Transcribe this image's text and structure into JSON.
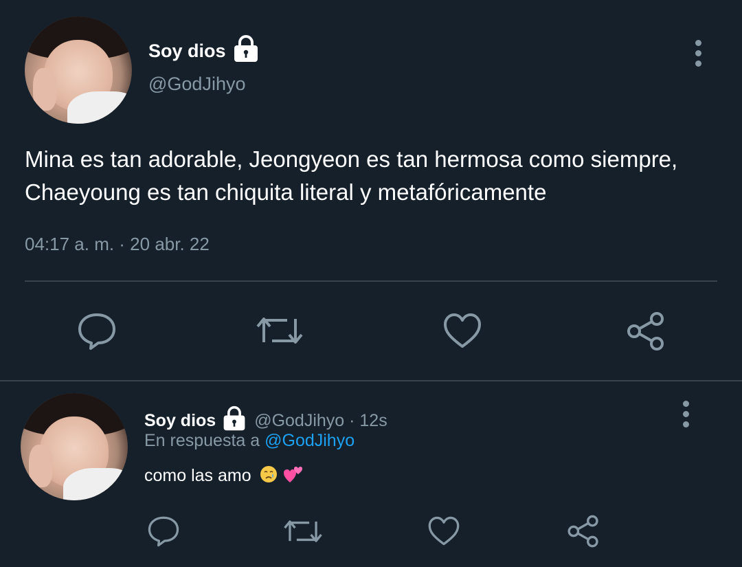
{
  "tweet": {
    "display_name": "Soy dios",
    "handle": "@GodJihyo",
    "text": "Mina es tan adorable, Jeongyeon es tan hermosa como siempre, Chaeyoung es tan chiquita literal y metafóricamente",
    "timestamp": "04:17 a. m. · 20 abr. 22",
    "avatar_icon": "profile-photo",
    "actions": [
      "reply-icon",
      "retweet-icon",
      "like-icon",
      "share-icon"
    ]
  },
  "reply": {
    "display_name": "Soy dios",
    "handle_time": "@GodJihyo · 12s",
    "replying_prefix": "En respuesta a",
    "replying_mention": "@GodJihyo",
    "text": "como las amo",
    "emojis": [
      "crying-face-icon",
      "two-hearts-icon"
    ],
    "actions": [
      "reply-icon",
      "retweet-icon",
      "like-icon",
      "share-icon"
    ]
  },
  "colors": {
    "background": "#15202b",
    "secondary_text": "#8899a6",
    "divider": "#38444d",
    "link": "#1da1f2",
    "icon": "#8899a6"
  }
}
